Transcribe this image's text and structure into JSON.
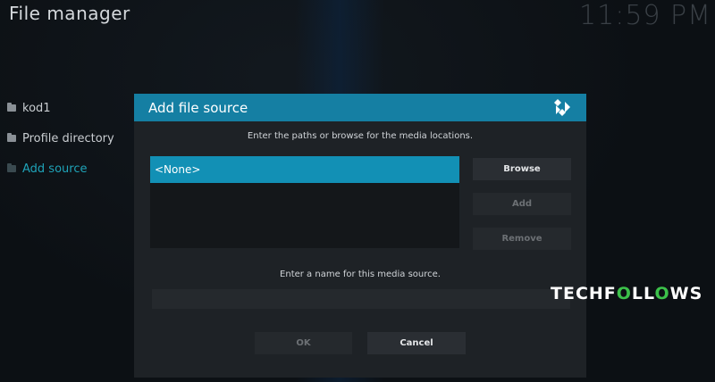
{
  "header": {
    "title": "File manager",
    "clock": "11:59 PM"
  },
  "sidebar": {
    "items": [
      {
        "label": "kod1",
        "active": false
      },
      {
        "label": "Profile directory",
        "active": false
      },
      {
        "label": "Add source",
        "active": true
      }
    ]
  },
  "dialog": {
    "title": "Add file source",
    "instruction_paths": "Enter the paths or browse for the media locations.",
    "paths": [
      "<None>"
    ],
    "browse_label": "Browse",
    "add_label": "Add",
    "remove_label": "Remove",
    "instruction_name": "Enter a name for this media source.",
    "name_value": "",
    "ok_label": "OK",
    "cancel_label": "Cancel"
  },
  "watermark": {
    "part1": "TECHF",
    "part2": "O",
    "part3": "LL",
    "part4": "O",
    "part5": "WS"
  },
  "colors": {
    "header_blue": "#157fa3",
    "selected_item": "#1290b5",
    "active_sidebar": "#1fa3b8",
    "background": "#0c1014",
    "dialog_bg": "#1e2226"
  }
}
